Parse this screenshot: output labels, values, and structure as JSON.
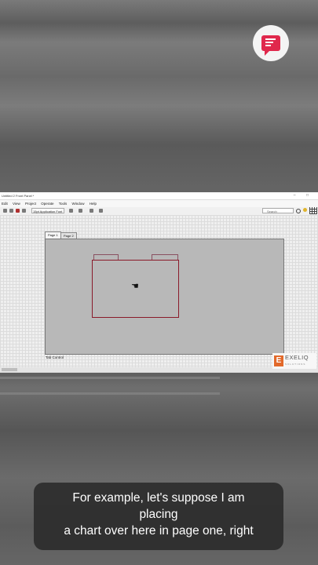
{
  "window": {
    "title": "Untitled 2 Front Panel *",
    "menu": [
      "Edit",
      "View",
      "Project",
      "Operate",
      "Tools",
      "Window",
      "Help"
    ],
    "font_select": "15pt Application Font",
    "search_placeholder": "Search"
  },
  "tabs": [
    "Page 1",
    "Page 2"
  ],
  "tab_control_label": "Tab Control",
  "logo": {
    "name": "EXELIQ",
    "sub": "SOLUTIONS",
    "mark": "E"
  },
  "caption": {
    "lines": [
      "For example, let's suppose I am",
      "placing",
      "a chart over here in page one, right"
    ]
  },
  "colors": {
    "badge_accent": "#e0284c",
    "logo_accent": "#e2692a"
  },
  "icons": [
    "comment-badge-icon",
    "run-arrow-icon",
    "run-continuous-icon",
    "abort-icon",
    "pause-icon",
    "search-icon",
    "help-icon",
    "grid-icon",
    "hand-cursor-icon"
  ]
}
